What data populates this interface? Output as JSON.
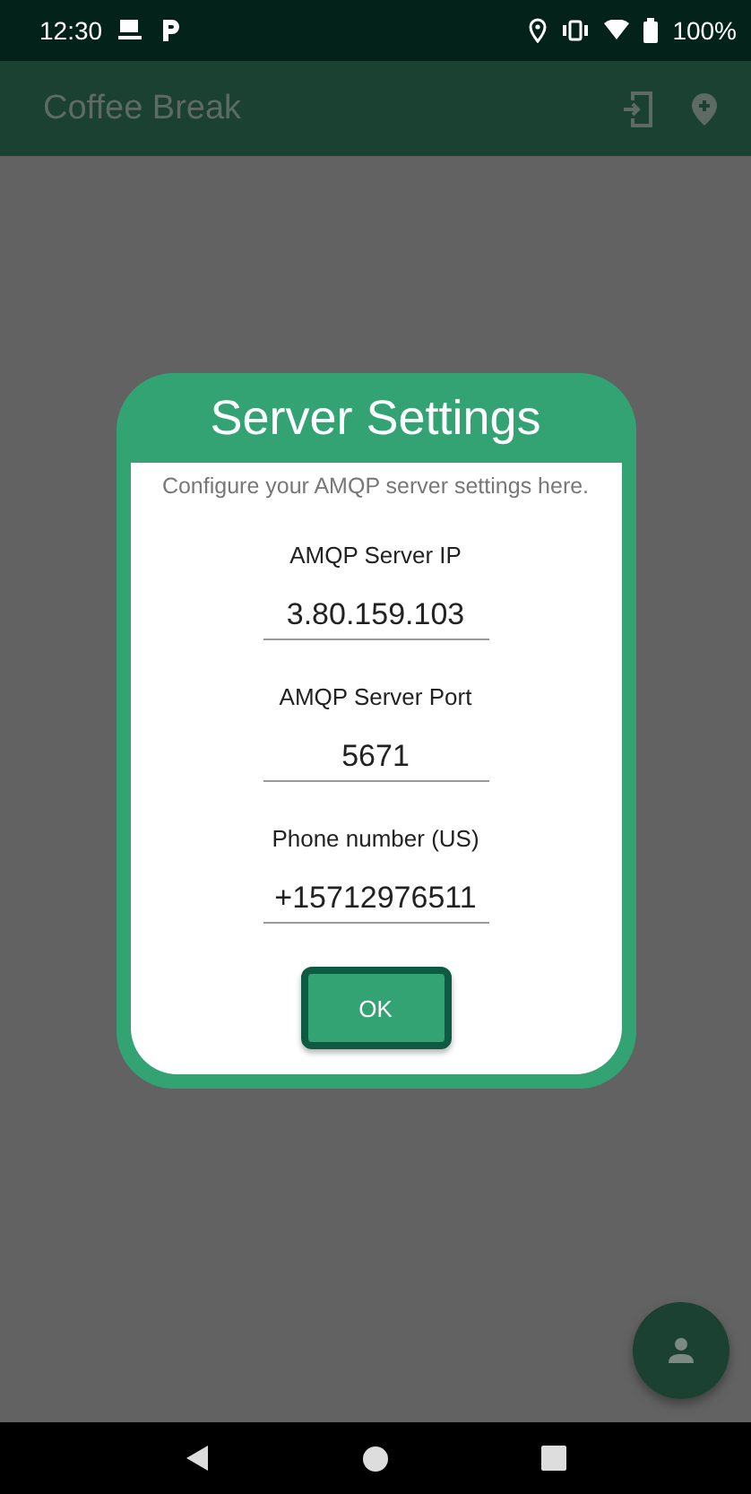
{
  "status_bar": {
    "time": "12:30",
    "battery": "100%"
  },
  "app_bar": {
    "title": "Coffee Break"
  },
  "dialog": {
    "title": "Server Settings",
    "description": "Configure your AMQP server settings here.",
    "fields": [
      {
        "label": "AMQP Server IP",
        "value": "3.80.159.103"
      },
      {
        "label": "AMQP Server Port",
        "value": "5671"
      },
      {
        "label": "Phone number (US)",
        "value": "+15712976511"
      }
    ],
    "button": "OK"
  }
}
